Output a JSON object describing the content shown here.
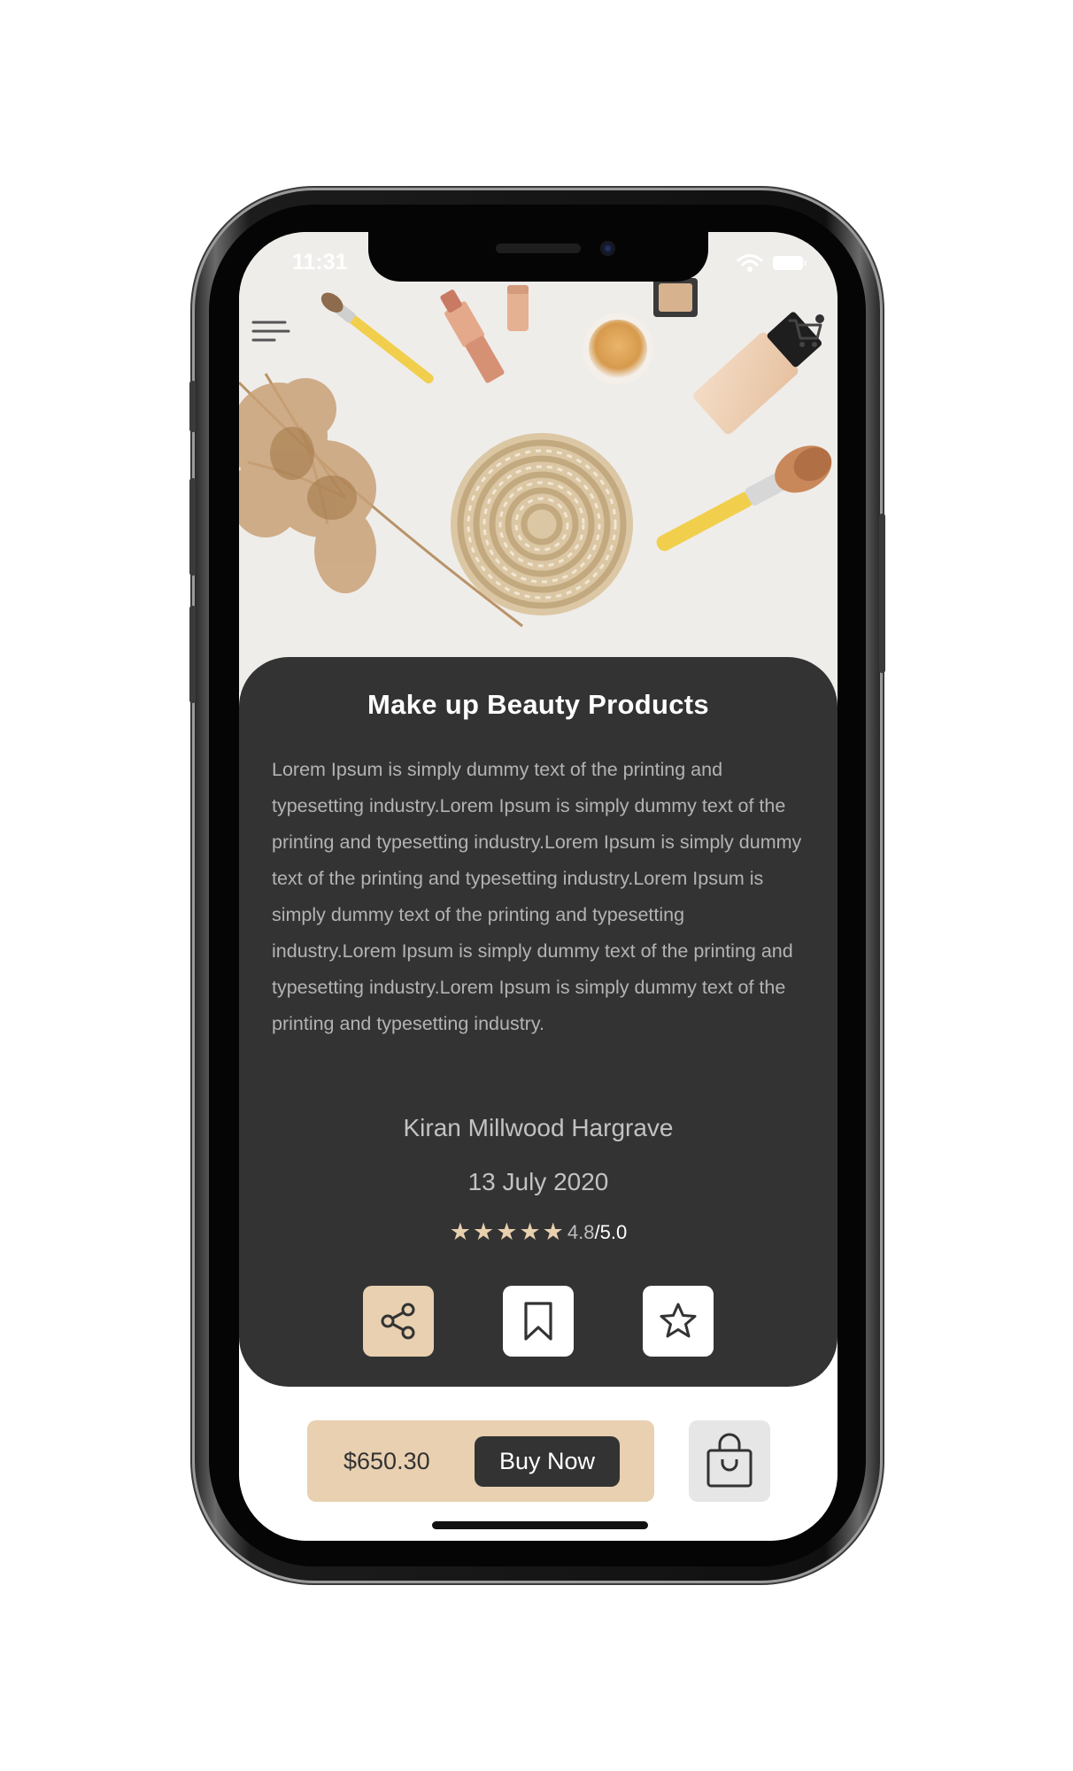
{
  "status_bar": {
    "time": "11:31"
  },
  "product": {
    "title": "Make up Beauty Products",
    "description": "Lorem Ipsum is simply dummy text of the printing and typesetting industry.Lorem Ipsum is simply dummy text of the printing and typesetting industry.Lorem Ipsum is simply dummy text of the printing and typesetting industry.Lorem Ipsum is simply dummy text of the printing and typesetting industry.Lorem Ipsum is simply dummy text of the printing and typesetting industry.Lorem Ipsum is simply dummy text of the printing and typesetting industry.",
    "author": "Kiran Millwood Hargrave",
    "date": "13 July 2020",
    "rating_value": "4.8",
    "rating_max": "/5.0",
    "stars": 5
  },
  "purchase": {
    "price": "$650.30",
    "buy_label": "Buy Now"
  },
  "icons": {
    "menu": "menu-icon",
    "cart": "cart-icon",
    "share": "share-icon",
    "bookmark": "bookmark-icon",
    "favorite": "star-outline-icon",
    "bag": "shopping-bag-icon"
  },
  "colors": {
    "card_bg": "#333333",
    "accent": "#e8d0b0",
    "star": "#e8cfae",
    "bag_bg": "#e6e6e6"
  }
}
